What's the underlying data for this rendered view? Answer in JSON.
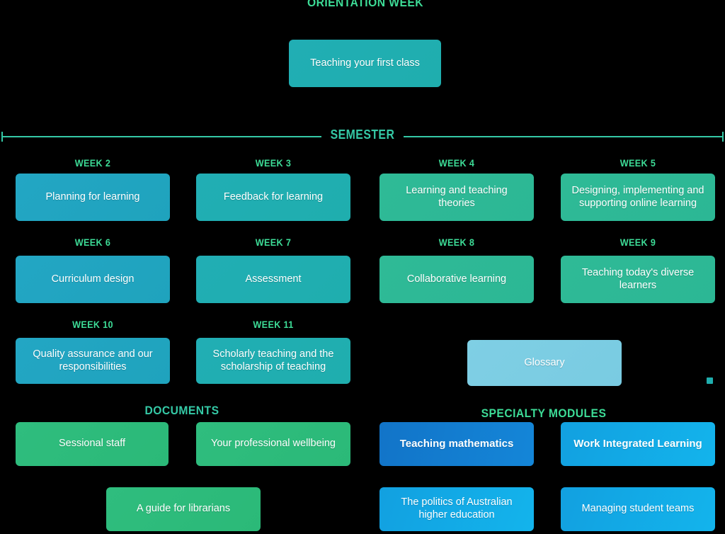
{
  "page": {
    "background": "#000000",
    "accent_green": "#3ddc97",
    "accent_teal": "#35c9a6"
  },
  "orientation": {
    "title": "ORIENTATION WEEK",
    "card": {
      "label": "Teaching your first class",
      "color": "#1fa3bd"
    }
  },
  "semester": {
    "divider_title": "SEMESTER",
    "weeks": [
      {
        "label": "WEEK 2",
        "title": "Planning for learning",
        "color": "#23a6c4"
      },
      {
        "label": "WEEK 3",
        "title": "Feedback for learning",
        "color": "#21aeb4"
      },
      {
        "label": "WEEK 4",
        "title": "Learning and teaching theories",
        "color": "#2fba96"
      },
      {
        "label": "WEEK 5",
        "title": "Designing, implementing and supporting online learning",
        "color": "#2cb795"
      },
      {
        "label": "WEEK 6",
        "title": "Curriculum design",
        "color": "#23a6c4"
      },
      {
        "label": "WEEK 7",
        "title": "Assessment",
        "color": "#21aeb4"
      },
      {
        "label": "WEEK 8",
        "title": "Collaborative learning",
        "color": "#2fba96"
      },
      {
        "label": "WEEK 9",
        "title": "Teaching today's diverse learners",
        "color": "#2cb795"
      },
      {
        "label": "WEEK 10",
        "title": "Quality assurance and our responsibilities",
        "color": "#23a6c4"
      },
      {
        "label": "WEEK 11",
        "title": "Scholarly teaching and the scholarship of teaching",
        "color": "#21aeb4"
      }
    ]
  },
  "glossary": {
    "label": "Glossary",
    "color": "#7fcfe4"
  },
  "documents": {
    "title": "DOCUMENTS",
    "items": [
      {
        "title": "Sessional staff",
        "color": "#2fbd7e"
      },
      {
        "title": "Your professional wellbeing",
        "color": "#2fbd7e"
      },
      {
        "title": "A guide for librarians",
        "color": "#2fbd7e"
      }
    ]
  },
  "specialty_modules": {
    "title": "SPECIALTY MODULES",
    "items": [
      {
        "title": "Teaching mathematics",
        "color": "#1274c8"
      },
      {
        "title": "Work Integrated Learning",
        "color": "#12a0e0"
      },
      {
        "title": "The politics of Australian higher education",
        "color": "#13b4ec"
      },
      {
        "title": "Managing student teams",
        "color": "#13b4ec"
      }
    ]
  }
}
